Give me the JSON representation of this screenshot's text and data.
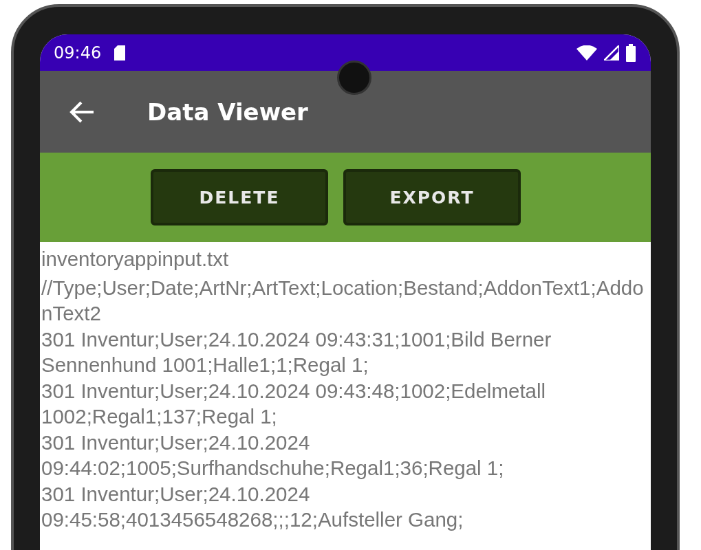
{
  "status_bar": {
    "time": "09:46"
  },
  "toolbar": {
    "title": "Data Viewer"
  },
  "buttons": [
    {
      "label": "DELETE"
    },
    {
      "label": "EXPORT"
    }
  ],
  "file_name": "inventoryappinput.txt",
  "lines": [
    "//Type;User;Date;ArtNr;ArtText;Location;Bestand;AddonText1;AddonText2",
    "301 Inventur;User;24.10.2024 09:43:31;1001;Bild Berner Sennenhund 1001;Halle1;1;Regal 1;",
    "301 Inventur;User;24.10.2024 09:43:48;1002;Edelmetall 1002;Regal1;137;Regal 1;",
    "301 Inventur;User;24.10.2024 09:44:02;1005;Surfhandschuhe;Regal1;36;Regal 1;",
    "301 Inventur;User;24.10.2024 09:45:58;4013456548268;;;12;Aufsteller Gang;"
  ]
}
